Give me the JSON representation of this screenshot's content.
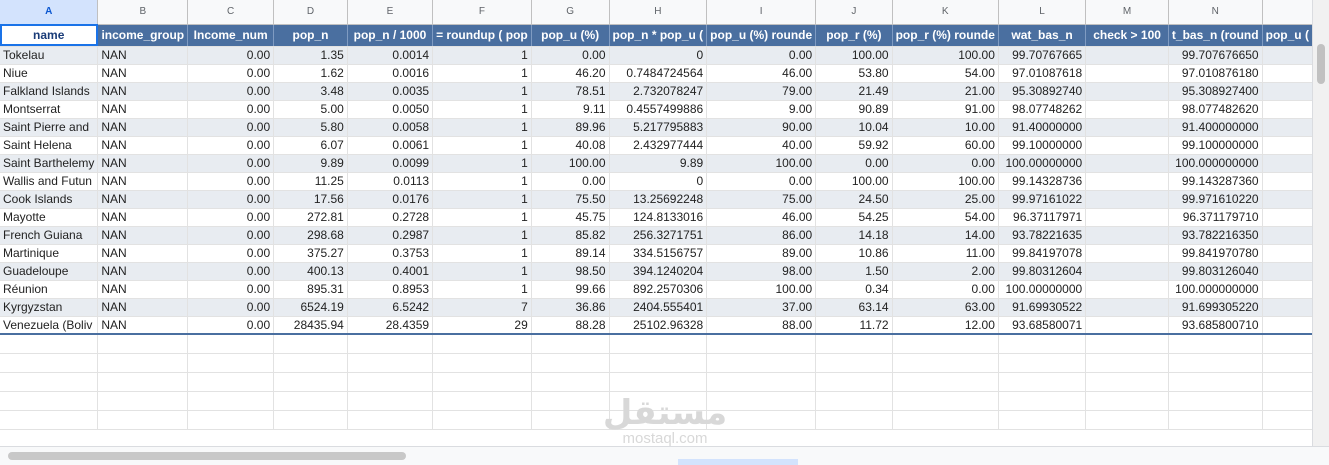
{
  "columns": {
    "letters": [
      "A",
      "B",
      "C",
      "D",
      "E",
      "F",
      "G",
      "H",
      "I",
      "J",
      "K",
      "L",
      "M",
      "N",
      ""
    ],
    "headers": [
      "name",
      "income_group",
      "Income_num",
      "pop_n",
      "pop_n / 1000",
      "= roundup ( pop",
      "pop_u (%)",
      "pop_n * pop_u  (",
      "pop_u (%) rounde",
      "pop_r (%)",
      "pop_r (%) rounde",
      "wat_bas_n",
      "check > 100",
      "t_bas_n (round",
      "pop_u ("
    ]
  },
  "rows": [
    [
      "Tokelau",
      "NAN",
      "0.00",
      "1.35",
      "0.0014",
      "1",
      "0.00",
      "0",
      "0.00",
      "100.00",
      "100.00",
      "99.70767665",
      "",
      "99.707676650",
      ""
    ],
    [
      "Niue",
      "NAN",
      "0.00",
      "1.62",
      "0.0016",
      "1",
      "46.20",
      "0.7484724564",
      "46.00",
      "53.80",
      "54.00",
      "97.01087618",
      "",
      "97.010876180",
      ""
    ],
    [
      "Falkland Islands",
      "NAN",
      "0.00",
      "3.48",
      "0.0035",
      "1",
      "78.51",
      "2.732078247",
      "79.00",
      "21.49",
      "21.00",
      "95.30892740",
      "",
      "95.308927400",
      ""
    ],
    [
      "Montserrat",
      "NAN",
      "0.00",
      "5.00",
      "0.0050",
      "1",
      "9.11",
      "0.4557499886",
      "9.00",
      "90.89",
      "91.00",
      "98.07748262",
      "",
      "98.077482620",
      ""
    ],
    [
      "Saint Pierre and",
      "NAN",
      "0.00",
      "5.80",
      "0.0058",
      "1",
      "89.96",
      "5.217795883",
      "90.00",
      "10.04",
      "10.00",
      "91.40000000",
      "",
      "91.400000000",
      ""
    ],
    [
      "Saint Helena",
      "NAN",
      "0.00",
      "6.07",
      "0.0061",
      "1",
      "40.08",
      "2.432977444",
      "40.00",
      "59.92",
      "60.00",
      "99.10000000",
      "",
      "99.100000000",
      ""
    ],
    [
      "Saint Barthelemy",
      "NAN",
      "0.00",
      "9.89",
      "0.0099",
      "1",
      "100.00",
      "9.89",
      "100.00",
      "0.00",
      "0.00",
      "100.00000000",
      "",
      "100.000000000",
      ""
    ],
    [
      "Wallis and Futun",
      "NAN",
      "0.00",
      "11.25",
      "0.0113",
      "1",
      "0.00",
      "0",
      "0.00",
      "100.00",
      "100.00",
      "99.14328736",
      "",
      "99.143287360",
      ""
    ],
    [
      "Cook Islands",
      "NAN",
      "0.00",
      "17.56",
      "0.0176",
      "1",
      "75.50",
      "13.25692248",
      "75.00",
      "24.50",
      "25.00",
      "99.97161022",
      "",
      "99.971610220",
      ""
    ],
    [
      "Mayotte",
      "NAN",
      "0.00",
      "272.81",
      "0.2728",
      "1",
      "45.75",
      "124.8133016",
      "46.00",
      "54.25",
      "54.00",
      "96.37117971",
      "",
      "96.371179710",
      ""
    ],
    [
      "French Guiana",
      "NAN",
      "0.00",
      "298.68",
      "0.2987",
      "1",
      "85.82",
      "256.3271751",
      "86.00",
      "14.18",
      "14.00",
      "93.78221635",
      "",
      "93.782216350",
      ""
    ],
    [
      "Martinique",
      "NAN",
      "0.00",
      "375.27",
      "0.3753",
      "1",
      "89.14",
      "334.5156757",
      "89.00",
      "10.86",
      "11.00",
      "99.84197078",
      "",
      "99.841970780",
      ""
    ],
    [
      "Guadeloupe",
      "NAN",
      "0.00",
      "400.13",
      "0.4001",
      "1",
      "98.50",
      "394.1240204",
      "98.00",
      "1.50",
      "2.00",
      "99.80312604",
      "",
      "99.803126040",
      ""
    ],
    [
      "Réunion",
      "NAN",
      "0.00",
      "895.31",
      "0.8953",
      "1",
      "99.66",
      "892.2570306",
      "100.00",
      "0.34",
      "0.00",
      "100.00000000",
      "",
      "100.000000000",
      ""
    ],
    [
      "Kyrgyzstan",
      "NAN",
      "0.00",
      "6524.19",
      "6.5242",
      "7",
      "36.86",
      "2404.555401",
      "37.00",
      "63.14",
      "63.00",
      "91.69930522",
      "",
      "91.699305220",
      ""
    ],
    [
      "Venezuela (Boliv",
      "NAN",
      "0.00",
      "28435.94",
      "28.4359",
      "29",
      "88.28",
      "25102.96328",
      "88.00",
      "11.72",
      "12.00",
      "93.68580071",
      "",
      "93.685800710",
      ""
    ]
  ],
  "watermark": {
    "arabic": "مستقل",
    "latin": "mostaql.com"
  }
}
